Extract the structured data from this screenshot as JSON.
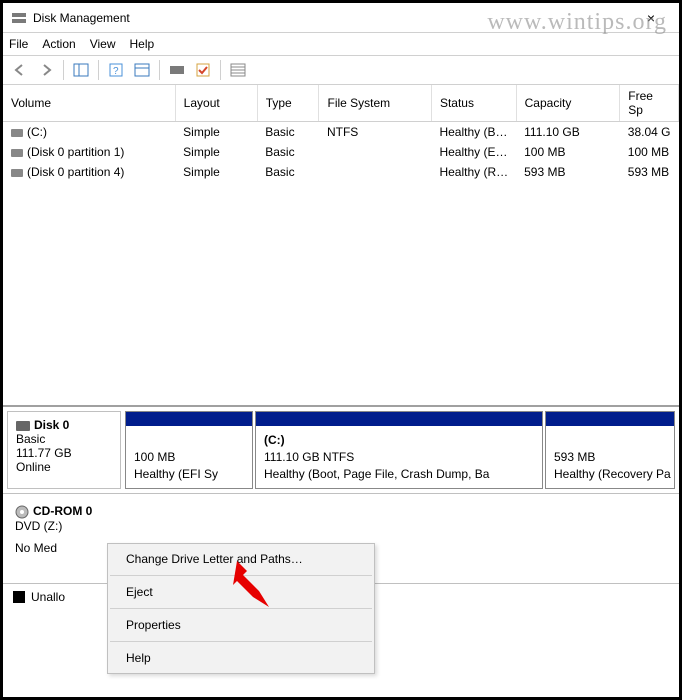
{
  "window": {
    "title": "Disk Management",
    "close": "×"
  },
  "menu": {
    "file": "File",
    "action": "Action",
    "view": "View",
    "help": "Help"
  },
  "columns": {
    "volume": "Volume",
    "layout": "Layout",
    "type": "Type",
    "fs": "File System",
    "status": "Status",
    "capacity": "Capacity",
    "free": "Free Sp"
  },
  "rows": [
    {
      "volume": "(C:)",
      "layout": "Simple",
      "type": "Basic",
      "fs": "NTFS",
      "status": "Healthy (B…",
      "capacity": "111.10 GB",
      "free": "38.04 G"
    },
    {
      "volume": "(Disk 0 partition 1)",
      "layout": "Simple",
      "type": "Basic",
      "fs": "",
      "status": "Healthy (E…",
      "capacity": "100 MB",
      "free": "100 MB"
    },
    {
      "volume": "(Disk 0 partition 4)",
      "layout": "Simple",
      "type": "Basic",
      "fs": "",
      "status": "Healthy (R…",
      "capacity": "593 MB",
      "free": "593 MB"
    }
  ],
  "disk0": {
    "name": "Disk 0",
    "kind": "Basic",
    "size": "111.77 GB",
    "state": "Online",
    "p1_size": "100 MB",
    "p1_status": "Healthy (EFI Sy",
    "p2_name": "(C:)",
    "p2_line": "111.10 GB NTFS",
    "p2_status": "Healthy (Boot, Page File, Crash Dump, Ba",
    "p3_size": "593 MB",
    "p3_status": "Healthy (Recovery Pa"
  },
  "cdrom": {
    "name": "CD-ROM 0",
    "line": "DVD (Z:)",
    "media": "No Med"
  },
  "legend": {
    "unalloc": "Unallo"
  },
  "ctx": {
    "change": "Change Drive Letter and Paths…",
    "eject": "Eject",
    "props": "Properties",
    "help": "Help"
  },
  "watermark": "www.wintips.org"
}
